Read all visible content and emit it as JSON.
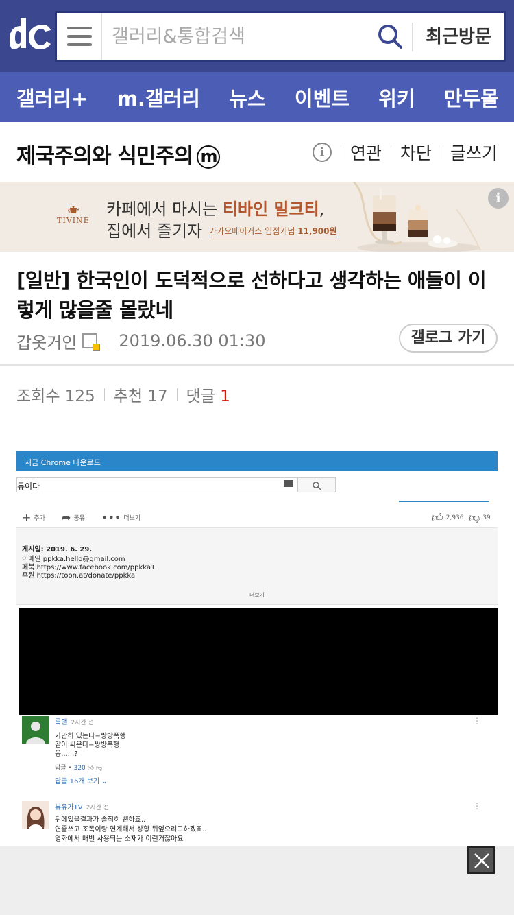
{
  "header": {
    "logo_icon": "dc-logo-icon",
    "search_placeholder": "갤러리&통합검색",
    "recent_label": "최근방문"
  },
  "nav": [
    "갤러리+",
    "m.갤러리",
    "뉴스",
    "이벤트",
    "위키",
    "만두몰"
  ],
  "gallery": {
    "title": "제국주의와 식민주의",
    "badge": "m",
    "info": "i",
    "actions": [
      "연관",
      "차단",
      "글쓰기"
    ]
  },
  "ad": {
    "brand": "TIVINE",
    "line1_a": "카페에서 마시는 ",
    "line1_b": "티바인 밀크티",
    "line1_c": ",",
    "line2": "집에서 즐기자",
    "promo_a": "카카오메이커스 입점기념 ",
    "promo_b": "11,900원",
    "info": "i"
  },
  "post": {
    "title": "[일반] 한국인이 도덕적으로 선하다고 생각하는 애들이 이렇게 많을줄 몰랐네",
    "author": "갑옷거인",
    "date": "2019.06.30 01:30",
    "gallog_label": "갤로그 가기",
    "views_label": "조회수 125",
    "recommend_label": "추천 17",
    "comments_label": "댓글",
    "comments_count": "1"
  },
  "shot": {
    "chrome_link": "지금 Chrome 다운로드",
    "search_value": "듀이다",
    "add_label": "추가",
    "share_label": "공유",
    "more_label": "더보기",
    "likes": "2,936",
    "dislikes": "39",
    "posted": "게시일: 2019. 6. 29.",
    "email": "이메일 ppkka.hello@gmail.com",
    "facebook": "페북 https://www.facebook.com/ppkka1",
    "donate": "후원 https://toon.at/donate/ppkka",
    "desc_more": "더보기",
    "comment1": {
      "name": "룩앤",
      "time": "2시간 전",
      "lines": [
        "가만히 있는다=쌍방폭행",
        "같이 싸운다=쌍방폭행",
        "응......?"
      ],
      "reply_label": "답글 •",
      "likes": "320",
      "replies": "답글 16개 보기"
    },
    "comment2": {
      "name": "뷰유가TV",
      "time": "2시간 전",
      "lines": [
        "뒤에있을결과가 솔직히 뻔하죠..",
        "연줄쓰고 조폭이랑 연계해서 상황 뒤엎으려고하겠죠..",
        "영화에서 매번 사용되는 소재가 이런거잖아요"
      ]
    }
  },
  "colors": {
    "topbar": "#3b4890",
    "navbar": "#4b5db4",
    "accent_red": "#d31900",
    "ad_bg": "#f2ebe3"
  }
}
